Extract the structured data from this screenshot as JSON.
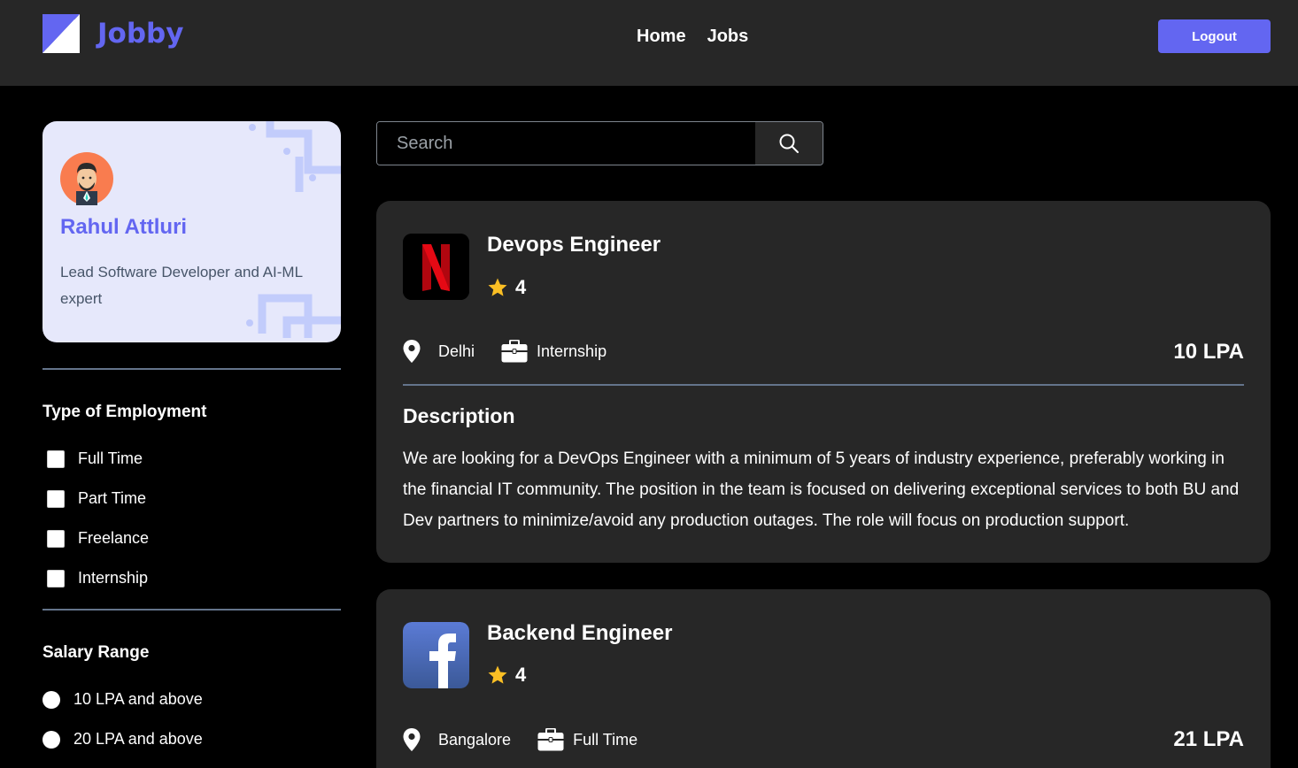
{
  "header": {
    "brand": "Jobby",
    "nav": [
      "Home",
      "Jobs"
    ],
    "logout_label": "Logout"
  },
  "profile": {
    "name": "Rahul Attluri",
    "bio": "Lead Software Developer and AI-ML expert"
  },
  "filters": {
    "employment_title": "Type of Employment",
    "employment_options": [
      "Full Time",
      "Part Time",
      "Freelance",
      "Internship"
    ],
    "salary_title": "Salary Range",
    "salary_options": [
      "10 LPA and above",
      "20 LPA and above"
    ]
  },
  "search": {
    "placeholder": "Search"
  },
  "jobs": [
    {
      "company_icon": "netflix-logo",
      "title": "Devops Engineer",
      "rating": "4",
      "location": "Delhi",
      "employment_type": "Internship",
      "salary": "10 LPA",
      "description_heading": "Description",
      "description": "We are looking for a DevOps Engineer with a minimum of 5 years of industry experience, preferably working in the financial IT community. The position in the team is focused on delivering exceptional services to both BU and Dev partners to minimize/avoid any production outages. The role will focus on production support."
    },
    {
      "company_icon": "facebook-logo",
      "title": "Backend Engineer",
      "rating": "4",
      "location": "Bangalore",
      "employment_type": "Full Time",
      "salary": "21 LPA"
    }
  ],
  "colors": {
    "accent": "#6366f1",
    "header_bg": "#272727",
    "card_bg": "#272727",
    "page_bg": "#000000",
    "star": "#fbbf24",
    "profile_bg": "#e6e8fb"
  }
}
